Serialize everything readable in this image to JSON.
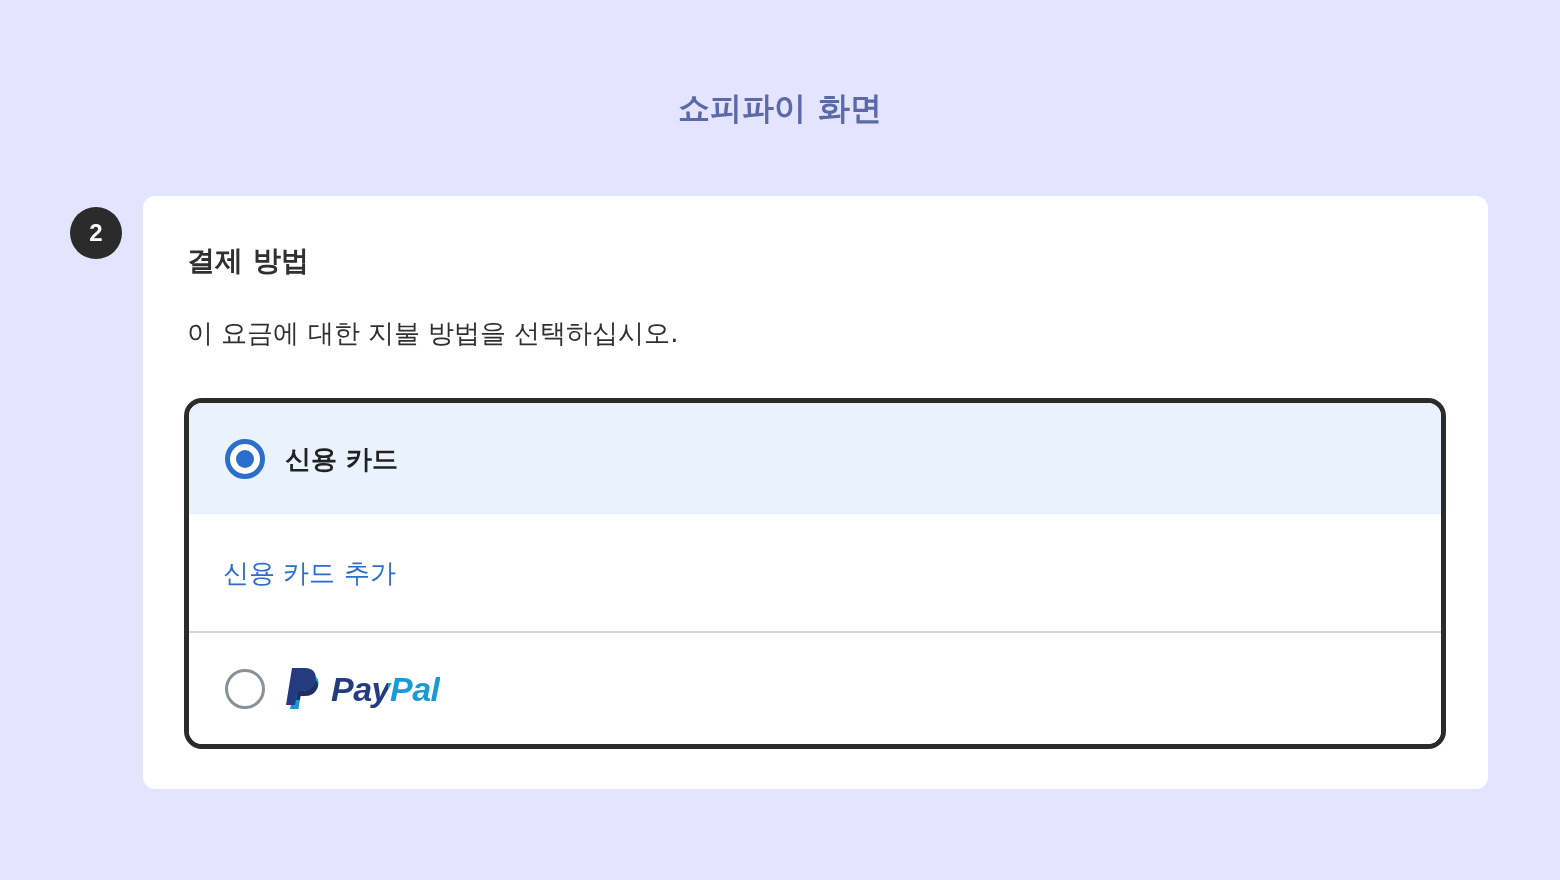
{
  "screen_title": "쇼피파이 화면",
  "step_number": "2",
  "payment_section": {
    "heading": "결제 방법",
    "description": "이 요금에 대한 지불 방법을 선택하십시오.",
    "options": [
      {
        "kind": "card",
        "label": "신용 카드",
        "selected": true,
        "link": "신용 카드 추가"
      },
      {
        "kind": "paypal",
        "label": "PayPal",
        "selected": false
      }
    ]
  }
}
